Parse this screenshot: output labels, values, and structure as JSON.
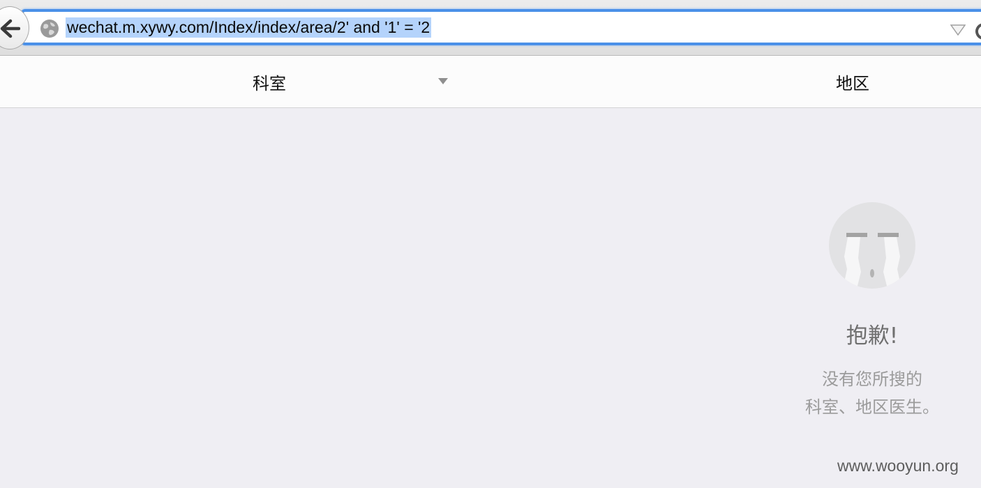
{
  "browser": {
    "url": "wechat.m.xywy.com/Index/index/area/2' and '1' = '2",
    "back_icon": "arrow-left-icon",
    "site_icon": "globe-icon",
    "reload_icon": "reload-icon"
  },
  "filters": {
    "department_label": "科室",
    "area_label": "地区"
  },
  "empty_state": {
    "title": "抱歉!",
    "message_line1": "没有您所搜的",
    "message_line2": "科室、地区医生。",
    "icon": "crying-face-icon"
  },
  "watermark": "www.wooyun.org",
  "colors": {
    "page_bg": "#efeef3",
    "url_focus_border": "#4a90e8",
    "url_selection": "#b4d3fb"
  }
}
